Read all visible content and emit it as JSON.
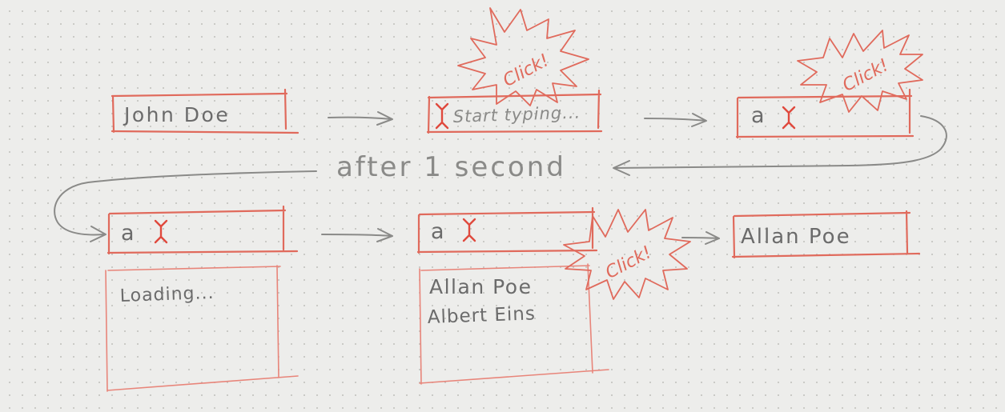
{
  "steps": {
    "step1_value": "John Doe",
    "step2_placeholder": "Start typing...",
    "step3_value": "a",
    "step4_value": "a",
    "step4_dropdown": "Loading...",
    "step5_value": "a",
    "step5_options": [
      "Allan Poe",
      "Albert Eins"
    ],
    "step6_value": "Allan Poe"
  },
  "annotations": {
    "delay_label": "after 1 second",
    "click_label": "Click!"
  },
  "colors": {
    "ink": "#6b6b6b",
    "sketch_red": "#e06a5c",
    "cursor_red": "#e0493d",
    "arrow_gray": "#8a8a88",
    "paper": "#ededeb"
  }
}
